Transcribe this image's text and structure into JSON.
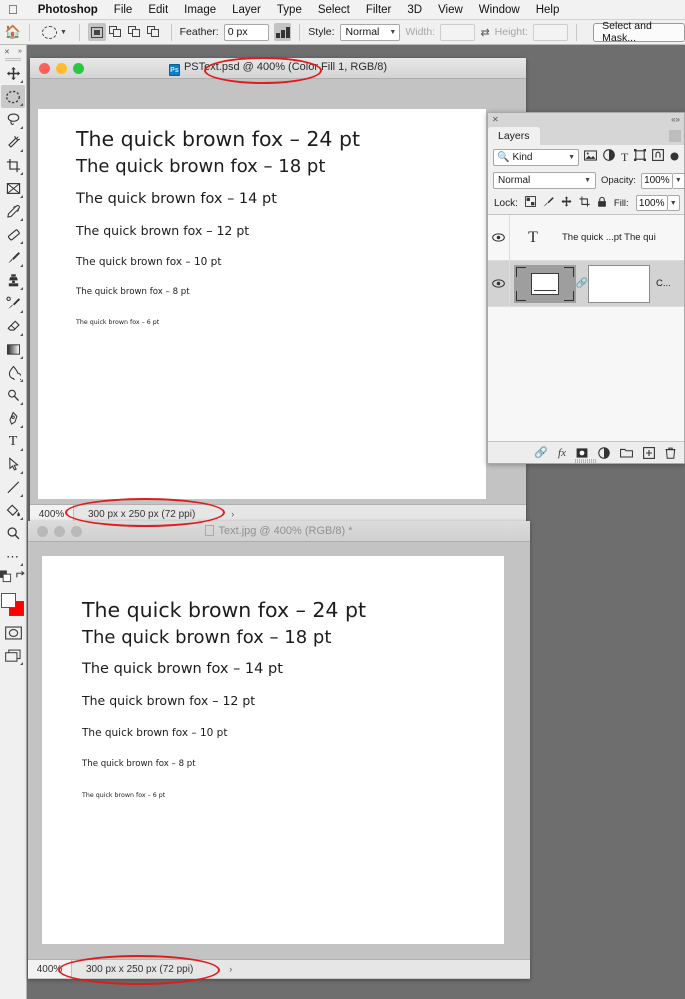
{
  "menubar": {
    "apple_icon": "apple-logo",
    "items": [
      "Photoshop",
      "File",
      "Edit",
      "Image",
      "Layer",
      "Type",
      "Select",
      "Filter",
      "3D",
      "View",
      "Window",
      "Help"
    ]
  },
  "options_bar": {
    "home_icon": "home-icon",
    "tool_preset_icon": "elliptical-marquee-icon",
    "selection_modes": [
      "new-selection-icon",
      "add-to-selection-icon",
      "subtract-from-selection-icon",
      "intersect-selection-icon"
    ],
    "feather_label": "Feather:",
    "feather_value": "0 px",
    "antialias_icon": "anti-alias-icon",
    "style_label": "Style:",
    "style_value": "Normal",
    "width_label": "Width:",
    "width_value": "",
    "swap_icon": "swap-dimensions-icon",
    "height_label": "Height:",
    "height_value": "",
    "select_and_mask_label": "Select and Mask..."
  },
  "toolbar": {
    "tools": [
      {
        "name": "move-tool",
        "active": false
      },
      {
        "name": "elliptical-marquee-tool",
        "active": true
      },
      {
        "name": "lasso-tool",
        "active": false
      },
      {
        "name": "magic-wand-tool",
        "active": false
      },
      {
        "name": "crop-tool",
        "active": false
      },
      {
        "name": "frame-tool",
        "active": false
      },
      {
        "name": "eyedropper-tool",
        "active": false
      },
      {
        "name": "spot-healing-brush-tool",
        "active": false
      },
      {
        "name": "brush-tool",
        "active": false
      },
      {
        "name": "clone-stamp-tool",
        "active": false
      },
      {
        "name": "history-brush-tool",
        "active": false
      },
      {
        "name": "eraser-tool",
        "active": false
      },
      {
        "name": "gradient-tool",
        "active": false
      },
      {
        "name": "blur-tool",
        "active": false
      },
      {
        "name": "dodge-tool",
        "active": false
      },
      {
        "name": "pen-tool",
        "active": false
      },
      {
        "name": "horizontal-type-tool",
        "active": false
      },
      {
        "name": "path-selection-tool",
        "active": false
      },
      {
        "name": "line-tool",
        "active": false
      },
      {
        "name": "paint-bucket-tool",
        "active": false
      },
      {
        "name": "zoom-tool",
        "active": false
      },
      {
        "name": "edit-toolbar-tool",
        "active": false
      }
    ],
    "foreground_color": "#ffffff",
    "background_color": "#ff0000",
    "quick_mask_icon": "quick-mask-icon",
    "screen_mode_icon": "screen-mode-icon"
  },
  "doc1": {
    "title": "PSText.psd @ 400% (Color Fill 1, RGB/8)",
    "file_icon": "photoshop-file-icon",
    "active": true,
    "zoom": "400%",
    "dimensions": "300 px x 250 px (72 ppi)",
    "status_arrow": "›",
    "lines": [
      {
        "text": "The quick brown fox – 24 pt",
        "size": 20.5
      },
      {
        "text": "The quick brown fox – 18 pt",
        "size": 18
      },
      {
        "text": "The quick brown fox – 14 pt",
        "size": 14.5
      },
      {
        "text": "The quick brown fox – 12 pt",
        "size": 12.5
      },
      {
        "text": "The quick brown fox – 10 pt",
        "size": 10.5
      },
      {
        "text": "The quick brown fox – 8 pt",
        "size": 8.5
      },
      {
        "text": "The quick brown fox – 6 pt",
        "size": 6.2
      }
    ]
  },
  "doc2": {
    "title": "Text.jpg @ 400% (RGB/8) *",
    "active": false,
    "zoom": "400%",
    "dimensions": "300 px x 250 px (72 ppi)",
    "status_arrow": "›",
    "lines": [
      {
        "text": "The quick brown fox – 24 pt",
        "size": 20.5
      },
      {
        "text": "The quick brown fox – 18 pt",
        "size": 18
      },
      {
        "text": "The quick brown fox – 14 pt",
        "size": 14.5
      },
      {
        "text": "The quick brown fox – 12 pt",
        "size": 12.5
      },
      {
        "text": "The quick brown fox – 10 pt",
        "size": 10.5
      },
      {
        "text": "The quick brown fox – 8 pt",
        "size": 8.5
      },
      {
        "text": "The quick brown fox – 6 pt",
        "size": 6.2
      }
    ]
  },
  "layers_panel": {
    "close_icon": "close-icon",
    "collapse_icon": "collapse-panel-icon",
    "tab_label": "Layers",
    "menu_icon": "panel-menu-icon",
    "filter": {
      "search_icon": "search-icon",
      "kind_label": "Kind",
      "caret_icon": "chevron-down-icon",
      "icons": [
        "filter-pixel-icon",
        "filter-adjustment-icon",
        "filter-type-icon",
        "filter-shape-icon",
        "filter-smart-object-icon",
        "filter-toggle-icon"
      ]
    },
    "blend_mode": "Normal",
    "opacity_label": "Opacity:",
    "opacity_value": "100%",
    "lock_label": "Lock:",
    "lock_icons": [
      "lock-transparent-pixels-icon",
      "lock-image-pixels-icon",
      "lock-position-icon",
      "lock-artboard-nesting-icon",
      "lock-all-icon"
    ],
    "fill_label": "Fill:",
    "fill_value": "100%",
    "layers": [
      {
        "name": "text-layer",
        "visible": true,
        "visibility_icon": "eye-icon",
        "thumb": "type-layer-thumbnail",
        "label": "The quick ...pt The qui",
        "selected": false
      },
      {
        "name": "color-fill-layer",
        "visible": true,
        "visibility_icon": "eye-icon",
        "thumb": "color-fill-thumbnail",
        "link_icon": "link-icon",
        "mask_thumb": "layer-mask-thumbnail",
        "label": "C...",
        "selected": true
      }
    ],
    "bottom_icons": [
      "link-layers-icon",
      "layer-style-fx-icon",
      "add-layer-mask-icon",
      "new-adjustment-layer-icon",
      "new-group-icon",
      "new-layer-icon",
      "delete-layer-icon"
    ]
  },
  "annotations": {
    "color": "#e01b1b",
    "ellipses": [
      {
        "name": "title-highlight-doc1"
      },
      {
        "name": "status-highlight-doc1"
      },
      {
        "name": "status-highlight-doc2"
      }
    ]
  }
}
